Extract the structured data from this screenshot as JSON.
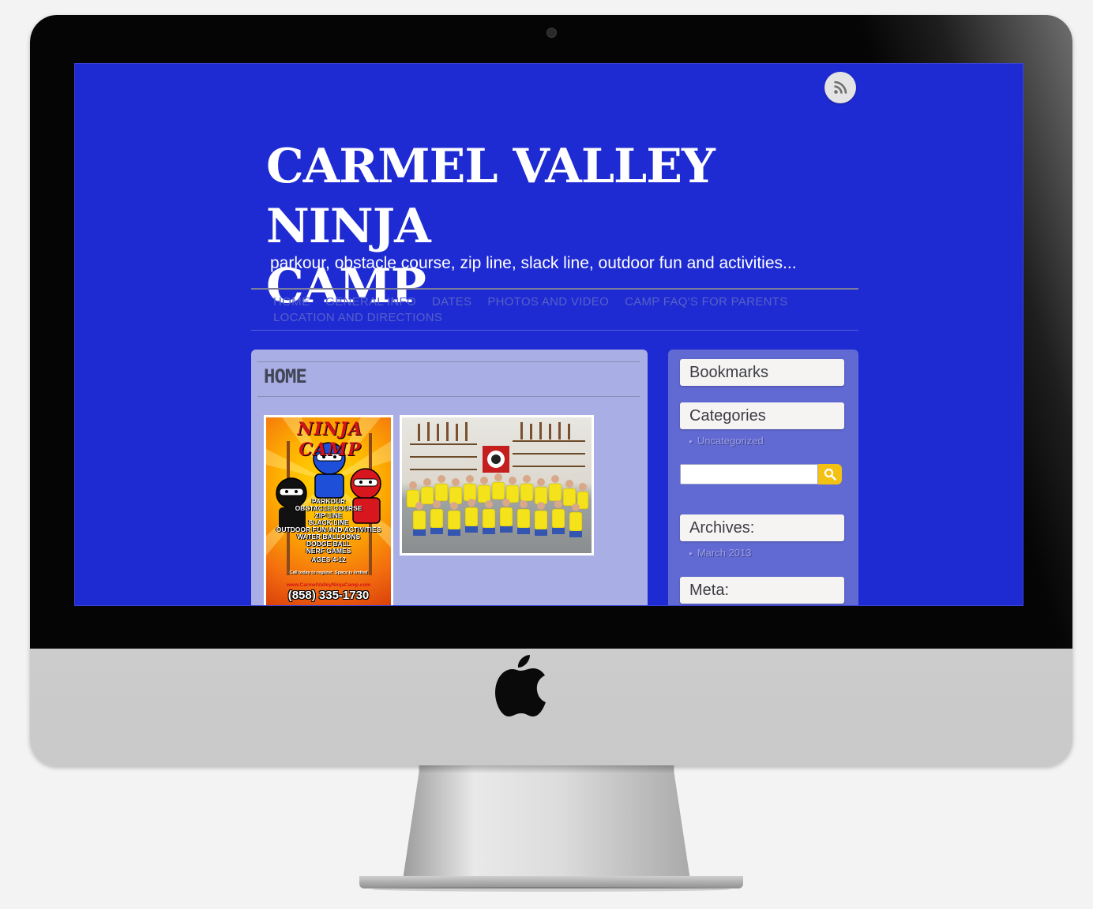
{
  "site": {
    "title_line1": "CARMEL VALLEY NINJA",
    "title_line2": "CAMP",
    "tagline": "parkour, obstacle course, zip line, slack line, outdoor fun and activities..."
  },
  "nav": {
    "row1": [
      "HOME",
      "GENERAL INFO",
      "DATES",
      "PHOTOS AND VIDEO",
      "CAMP FAQ'S FOR PARENTS"
    ],
    "row2": [
      "LOCATION AND DIRECTIONS"
    ]
  },
  "page": {
    "heading": "HOME"
  },
  "flyer": {
    "title": "NINJA CAMP",
    "lines": [
      "PARKOUR",
      "OBSTACLE COURSE",
      "ZIP LINE",
      "SLACK LINE",
      "OUTDOOR FUN AND ACTIVITIES",
      "WATER BALLOONS",
      "DODGE BALL",
      "NERF GAMES",
      "AGES 4-12"
    ],
    "cta": "Call today to register. Space is limited",
    "url": "www.CarmelValleyNinjaCamp.com",
    "phone": "(858) 335-1730"
  },
  "sidebar": {
    "bookmarks_title": "Bookmarks",
    "categories_title": "Categories",
    "categories": [
      "Uncategorized"
    ],
    "archives_title": "Archives:",
    "archives": [
      "March 2013"
    ],
    "meta_title": "Meta:"
  },
  "colors": {
    "page_background": "#1f2bd2",
    "content_panel": "#a9aee4",
    "sidebar_panel": "#6169d3",
    "nav_text": "#5561c9",
    "search_button": "#f3c112"
  },
  "icons": {
    "rss": "rss-icon",
    "search": "search-icon",
    "apple": "apple-logo-icon"
  }
}
